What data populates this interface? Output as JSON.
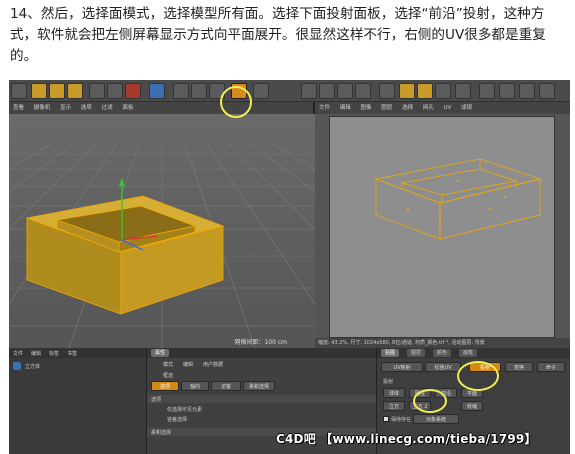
{
  "instruction": {
    "line1": "14、然后，选择面模式，选择模型所有面。选择下面投射面板，选择“前沿”投射，这种方",
    "line2": "式，软件就会把左侧屏幕显示方式向平面展开。很显然这样不行，右侧的UV很多都是重复",
    "line3": "的。"
  },
  "left_viewport": {
    "menu": [
      "查看",
      "摄像机",
      "显示",
      "选项",
      "过滤",
      "面板"
    ],
    "grid_spacing": "网格间距：100 cm"
  },
  "right_viewport": {
    "menu": [
      "文件",
      "编辑",
      "图像",
      "图层",
      "选择",
      "网孔",
      "UV",
      "滤镜"
    ],
    "status": "缩放: 43.2%, 尺寸: 1024x580, 8位/通道, 材质_颜色.tif *, 活动图层: 背景"
  },
  "object_manager": {
    "menu": [
      "文件",
      "编辑",
      "标签",
      "书签"
    ],
    "item": "立方体"
  },
  "attribute_manager": {
    "tabs": [
      "属性"
    ],
    "menu": [
      "模式",
      "编辑",
      "用户数据"
    ],
    "title": "框选",
    "subtabs": [
      "选项",
      "轴向",
      "访客",
      "柔和选择"
    ],
    "section": "选项",
    "rows": [
      "仅选择可见元素",
      "容差选择",
      "柔和选择"
    ]
  },
  "texture_panel": {
    "tabs": [
      "贴图",
      "图层",
      "颜色",
      "画笔"
    ],
    "row1": [
      "UV映射",
      "松弛UV",
      "投射"
    ],
    "row1b": [
      "变换",
      "命令"
    ],
    "section": "投射",
    "proj_buttons": [
      "球体",
      "圆柱",
      "前沿",
      "平面",
      "立方",
      "立方 2",
      "收缩"
    ],
    "checkbox_label": "保持存在",
    "dropdown": "对象系统"
  },
  "watermark": "C4D吧 【www.linecg.com/tieba/1799】",
  "colors": {
    "mesh_fill": "#c9a227",
    "mesh_edge": "#f2a900",
    "highlight": "#f1ee54",
    "active_button": "#d28a14"
  }
}
